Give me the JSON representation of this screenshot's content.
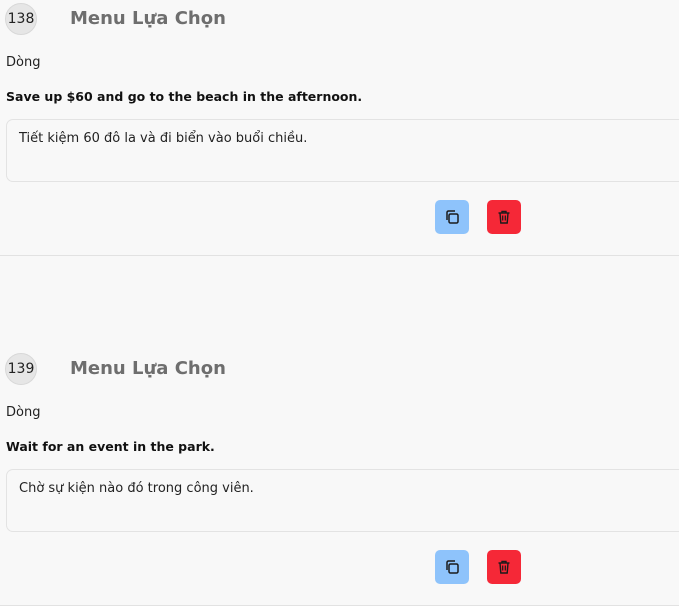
{
  "entries": [
    {
      "number": "138",
      "menu_title": "Menu Lựa Chọn",
      "row_label": "Dòng",
      "source_text": "Save up $60 and go to the beach in the afternoon.",
      "translation": "Tiết kiệm 60 đô la và đi biển vào buổi chiều."
    },
    {
      "number": "139",
      "menu_title": "Menu Lựa Chọn",
      "row_label": "Dòng",
      "source_text": "Wait for an event in the park.",
      "translation": "Chờ sự kiện nào đó trong công viên."
    }
  ],
  "icons": {
    "copy": "copy-icon",
    "delete": "trash-icon"
  },
  "colors": {
    "copy_button": "#8ec3fb",
    "delete_button": "#f52837",
    "title_text": "#6e6e6e",
    "background": "#f8f8f8"
  }
}
